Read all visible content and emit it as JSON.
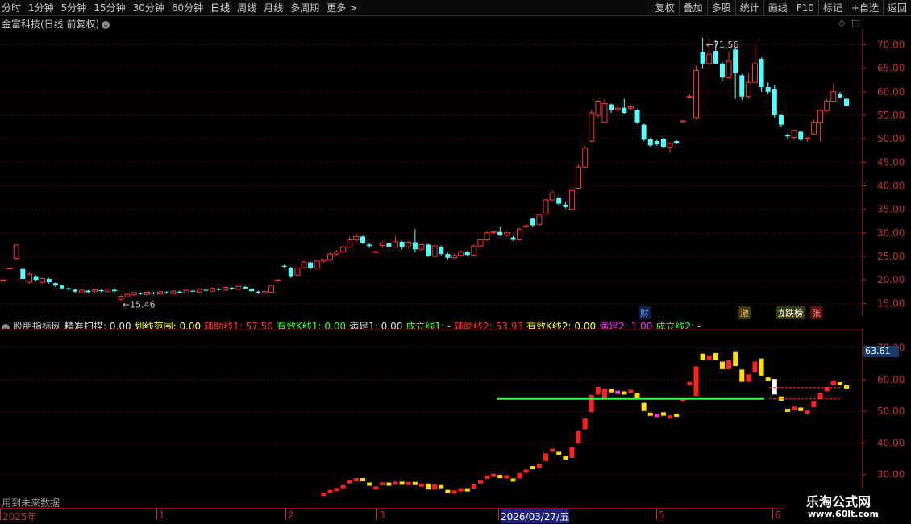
{
  "toolbar": {
    "left": [
      "分时",
      "1分钟",
      "5分钟",
      "15分钟",
      "30分钟",
      "60分钟",
      "日线",
      "周线",
      "月线",
      "多周期",
      "更多"
    ],
    "active": "日线",
    "more_arrow": ">",
    "right": [
      "复权",
      "叠加",
      "多股",
      "统计",
      "画线",
      "F10",
      "标记",
      "+自选",
      "返回"
    ]
  },
  "main_title": "金富科技(日线 前复权)",
  "main_chart": {
    "price_axis": [
      "70.00",
      "65.00",
      "60.00",
      "55.00",
      "50.00",
      "45.00",
      "40.00",
      "35.00",
      "30.00",
      "25.00",
      "20.00",
      "15.00"
    ],
    "y_range": [
      13.0,
      73.0
    ],
    "high_label": "71.56",
    "low_label": "15.46",
    "up_color": "#ff3333",
    "down_color": "#54ffff",
    "candles": [
      [
        20,
        20,
        20,
        20
      ],
      [
        22.5,
        22.5,
        22.5,
        22.5
      ],
      [
        24.6,
        27.4,
        24.2,
        27.6
      ],
      [
        22.3,
        20.2,
        19.9,
        22.5
      ],
      [
        19.5,
        21.2,
        19.2,
        21.5
      ],
      [
        20.8,
        20.0,
        19.7,
        21.0
      ],
      [
        19.5,
        20.3,
        19.4,
        20.5
      ],
      [
        20.2,
        19.5,
        19.2,
        20.4
      ],
      [
        19.3,
        18.8,
        18.5,
        19.5
      ],
      [
        18.8,
        18.2,
        17.9,
        19.0
      ],
      [
        18.2,
        18.0,
        17.7,
        18.4
      ],
      [
        17.9,
        17.5,
        17.2,
        18.1
      ],
      [
        17.3,
        17.8,
        17.2,
        18.0
      ],
      [
        17.7,
        17.4,
        17.1,
        17.9
      ],
      [
        17.6,
        17.9,
        17.4,
        18.1
      ],
      [
        17.8,
        17.6,
        17.4,
        18.0
      ],
      [
        17.5,
        18.0,
        17.4,
        18.2
      ],
      [
        17.9,
        17.6,
        17.3,
        18.2
      ],
      [
        15.9,
        16.5,
        15.5,
        16.8
      ],
      [
        16.4,
        16.9,
        16.2,
        17.1
      ],
      [
        16.8,
        17.3,
        16.6,
        17.4
      ],
      [
        17.2,
        17.0,
        16.8,
        17.4
      ],
      [
        16.9,
        17.4,
        16.7,
        17.5
      ],
      [
        17.3,
        17.1,
        16.9,
        17.5
      ],
      [
        17.0,
        17.5,
        16.9,
        17.7
      ],
      [
        17.4,
        17.2,
        17.0,
        17.6
      ],
      [
        17.1,
        17.6,
        17.0,
        17.8
      ],
      [
        17.5,
        17.3,
        17.1,
        17.7
      ],
      [
        17.2,
        17.8,
        17.1,
        18.0
      ],
      [
        17.7,
        17.5,
        17.3,
        17.9
      ],
      [
        17.4,
        18.0,
        17.3,
        18.2
      ],
      [
        17.9,
        17.7,
        17.5,
        18.1
      ],
      [
        17.6,
        18.2,
        17.5,
        18.4
      ],
      [
        18.1,
        17.9,
        17.7,
        18.3
      ],
      [
        17.8,
        18.4,
        17.7,
        18.6
      ],
      [
        18.3,
        18.1,
        17.9,
        18.5
      ],
      [
        18.0,
        18.6,
        17.9,
        18.8
      ],
      [
        18.5,
        18.2,
        18.0,
        18.7
      ],
      [
        18.1,
        17.6,
        17.4,
        18.3
      ],
      [
        17.5,
        17.2,
        17.0,
        17.7
      ],
      [
        17.2,
        17.5,
        17.0,
        17.7
      ],
      [
        17.4,
        18.8,
        17.3,
        19.0
      ],
      [
        20.0,
        20.0,
        20.0,
        20.0
      ],
      [
        23.0,
        22.8,
        22.5,
        23.2
      ],
      [
        22.5,
        20.8,
        20.4,
        22.8
      ],
      [
        21.0,
        22.5,
        20.8,
        22.8
      ],
      [
        22.6,
        23.8,
        22.4,
        24.0
      ],
      [
        23.7,
        22.5,
        22.2,
        23.9
      ],
      [
        22.5,
        24.0,
        22.3,
        24.2
      ],
      [
        24.0,
        24.3,
        23.7,
        24.5
      ],
      [
        24.3,
        25.5,
        24.0,
        25.8
      ],
      [
        25.5,
        26.0,
        25.2,
        26.3
      ],
      [
        26.0,
        27.0,
        25.7,
        27.3
      ],
      [
        27.0,
        28.5,
        26.8,
        29.2
      ],
      [
        28.5,
        29.2,
        28.0,
        30.0
      ],
      [
        29.2,
        27.9,
        27.6,
        29.5
      ],
      [
        27.5,
        27.2,
        26.8,
        27.8
      ],
      [
        26.0,
        26.0,
        25.7,
        26.3
      ],
      [
        27.3,
        27.8,
        26.9,
        28.2
      ],
      [
        27.8,
        27.0,
        26.7,
        28.0
      ],
      [
        27.0,
        28.1,
        26.8,
        29.2
      ],
      [
        28.1,
        27.0,
        26.5,
        28.3
      ],
      [
        27.0,
        28.0,
        26.7,
        28.3
      ],
      [
        28.0,
        26.5,
        25.8,
        30.8
      ],
      [
        26.5,
        27.5,
        26.2,
        27.8
      ],
      [
        27.5,
        25.0,
        24.8,
        27.7
      ],
      [
        25.0,
        27.2,
        24.8,
        27.5
      ],
      [
        27.0,
        25.5,
        25.2,
        27.3
      ],
      [
        25.5,
        24.7,
        24.3,
        25.8
      ],
      [
        24.7,
        25.2,
        24.5,
        25.5
      ],
      [
        25.2,
        26.0,
        25.0,
        26.3
      ],
      [
        26.0,
        25.3,
        25.0,
        26.2
      ],
      [
        25.3,
        27.2,
        25.1,
        27.5
      ],
      [
        27.2,
        28.5,
        26.9,
        28.8
      ],
      [
        28.5,
        30.0,
        28.2,
        30.3
      ],
      [
        30.0,
        30.2,
        29.7,
        30.5
      ],
      [
        30.2,
        29.5,
        29.3,
        31.3
      ],
      [
        29.5,
        30.0,
        29.2,
        30.3
      ],
      [
        29.0,
        28.5,
        28.3,
        29.3
      ],
      [
        28.5,
        30.8,
        28.3,
        31.0
      ],
      [
        31.3,
        31.5,
        31.0,
        31.8
      ],
      [
        33.0,
        31.6,
        31.3,
        33.2
      ],
      [
        31.8,
        33.8,
        31.5,
        34.0
      ],
      [
        34.0,
        37.0,
        33.8,
        37.2
      ],
      [
        37.0,
        38.5,
        36.8,
        39.0
      ],
      [
        37.5,
        36.2,
        35.8,
        38.0
      ],
      [
        36.0,
        35.5,
        35.2,
        36.5
      ],
      [
        35.0,
        39.0,
        34.7,
        39.3
      ],
      [
        39.5,
        44.0,
        39.3,
        44.5
      ],
      [
        44.0,
        48.0,
        43.7,
        48.5
      ],
      [
        49.5,
        55.5,
        49.2,
        56.2
      ],
      [
        55.0,
        58.0,
        54.5,
        58.3
      ],
      [
        53.5,
        57.5,
        53.2,
        58.5
      ],
      [
        57.3,
        56.2,
        55.5,
        57.5
      ],
      [
        56.2,
        56.5,
        55.8,
        57.2
      ],
      [
        56.6,
        55.5,
        55.2,
        58.5
      ],
      [
        56.5,
        56.8,
        56.1,
        56.9
      ],
      [
        56.1,
        53.5,
        53.2,
        56.3
      ],
      [
        53.0,
        49.8,
        49.5,
        53.3
      ],
      [
        49.9,
        48.6,
        48.3,
        50.2
      ],
      [
        49.5,
        48.8,
        48.5,
        49.8
      ],
      [
        50.0,
        48.3,
        48.0,
        50.2
      ],
      [
        48.2,
        49.0,
        47.0,
        49.3
      ],
      [
        49.5,
        49.0,
        48.8,
        49.7
      ],
      [
        53.8,
        53.8,
        53.8,
        53.8
      ],
      [
        59.0,
        59.0,
        58.8,
        59.5
      ],
      [
        54.5,
        64.5,
        54.2,
        65.5
      ],
      [
        68.5,
        66.0,
        65.0,
        71.5
      ],
      [
        66.0,
        68.0,
        65.5,
        71.5
      ],
      [
        68.7,
        66.0,
        65.8,
        71.0
      ],
      [
        66.0,
        63.0,
        62.2,
        66.4
      ],
      [
        63.0,
        66.5,
        62.8,
        68.5
      ],
      [
        69.0,
        64.0,
        58.5,
        69.3
      ],
      [
        63.5,
        59.0,
        58.2,
        63.8
      ],
      [
        59.0,
        62.0,
        58.5,
        64.0
      ],
      [
        62.0,
        66.0,
        61.8,
        70.5
      ],
      [
        67.0,
        61.0,
        60.0,
        67.3
      ],
      [
        61.0,
        60.0,
        59.5,
        62.0
      ],
      [
        60.5,
        55.0,
        54.5,
        61.5
      ],
      [
        55.0,
        53.0,
        52.5,
        55.3
      ],
      [
        50.8,
        50.5,
        49.8,
        51.2
      ],
      [
        50.3,
        51.8,
        49.8,
        52.0
      ],
      [
        51.5,
        49.8,
        49.5,
        51.8
      ],
      [
        50.0,
        50.2,
        49.3,
        50.4
      ],
      [
        51.0,
        53.5,
        50.8,
        54.0
      ],
      [
        53.5,
        56.0,
        49.5,
        56.3
      ],
      [
        56.0,
        58.0,
        55.7,
        58.5
      ],
      [
        58.0,
        60.0,
        57.7,
        61.8
      ],
      [
        59.5,
        58.8,
        58.5,
        60.0
      ],
      [
        58.5,
        57.0,
        56.8,
        58.8
      ]
    ]
  },
  "event_tags": [
    {
      "label": "财",
      "color": "#6aa0ff"
    },
    {
      "label": "激",
      "color": "#ffb060"
    },
    {
      "label": "龙",
      "color": "#ffffff"
    },
    {
      "label": "跌榜",
      "color": "#ffffff"
    },
    {
      "label": "张",
      "color": "#ff9090"
    }
  ],
  "indicator": {
    "name": "股朋指标网",
    "items": [
      {
        "text": "精准扫描: 0.00",
        "color": "#e0e0e0"
      },
      {
        "text": "划线范围: 0.00",
        "color": "#ffff30"
      },
      {
        "text": "辅助线1: 57.50",
        "color": "#ff3030"
      },
      {
        "text": "有效K线1: 0.00",
        "color": "#30ff30"
      },
      {
        "text": "满足1: 0.00",
        "color": "#e0e0e0"
      },
      {
        "text": "成立线1: -",
        "color": "#30ff30"
      },
      {
        "text": "辅助线2: 53.93",
        "color": "#ff3030"
      },
      {
        "text": "有效K线2: 0.00",
        "color": "#ffff30"
      },
      {
        "text": "满足2: 1.00",
        "color": "#ff30ff"
      },
      {
        "text": "成立线2: -",
        "color": "#30ff30"
      }
    ],
    "axis": [
      "70.00",
      "60.00",
      "50.00",
      "40.00",
      "30.00"
    ],
    "y_range": [
      20.0,
      75.0
    ],
    "current_value": "63.61",
    "green_line": 53.93
  },
  "future_note": "用到未来数据",
  "date_axis": [
    {
      "label": "2025年"
    },
    {
      "label": "1"
    },
    {
      "label": "2"
    },
    {
      "label": "3"
    },
    {
      "label": "2026/03/27/五"
    },
    {
      "label": "5"
    },
    {
      "label": "6"
    }
  ],
  "watermark": {
    "line1": "乐淘公式网",
    "line2": "www.60lt.com"
  }
}
